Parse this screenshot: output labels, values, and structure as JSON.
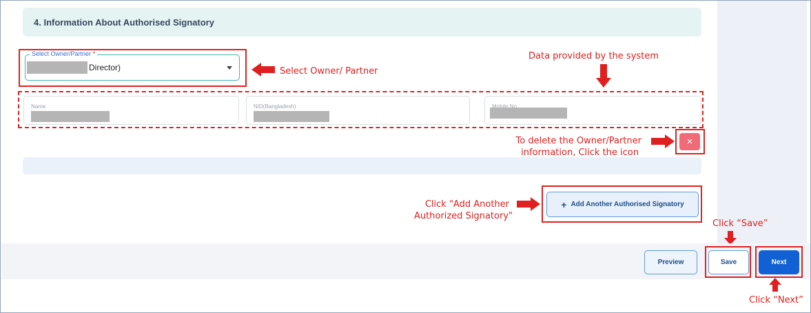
{
  "section": {
    "title": "4. Information About Authorised Signatory"
  },
  "select_owner": {
    "label": "Select Owner/Partner",
    "required_mark": "*",
    "value": "Director)"
  },
  "fields": [
    {
      "label": "Name"
    },
    {
      "label": "NID(Bangladesh)"
    },
    {
      "label": "Mobile No"
    }
  ],
  "buttons": {
    "delete_symbol": "×",
    "add_symbol": "+",
    "add_label": "Add Another Authorised Signatory",
    "preview": "Preview",
    "save": "Save",
    "next": "Next"
  },
  "annotations": {
    "select_owner": "Select Owner/ Partner",
    "system_data": "Data provided by the system",
    "delete_line1": "To delete the Owner/Partner",
    "delete_line2": "information, Click the icon",
    "add_line1": "Click \"Add Another",
    "add_line2": "Authorized Signatory\"",
    "save": "Click “Save”",
    "next": "Click “Next”"
  },
  "colors": {
    "annotation_red": "#e02020",
    "primary_blue": "#1160d4",
    "delete_pink": "#f06a78",
    "header_teal_bg": "#e6f3f3"
  }
}
